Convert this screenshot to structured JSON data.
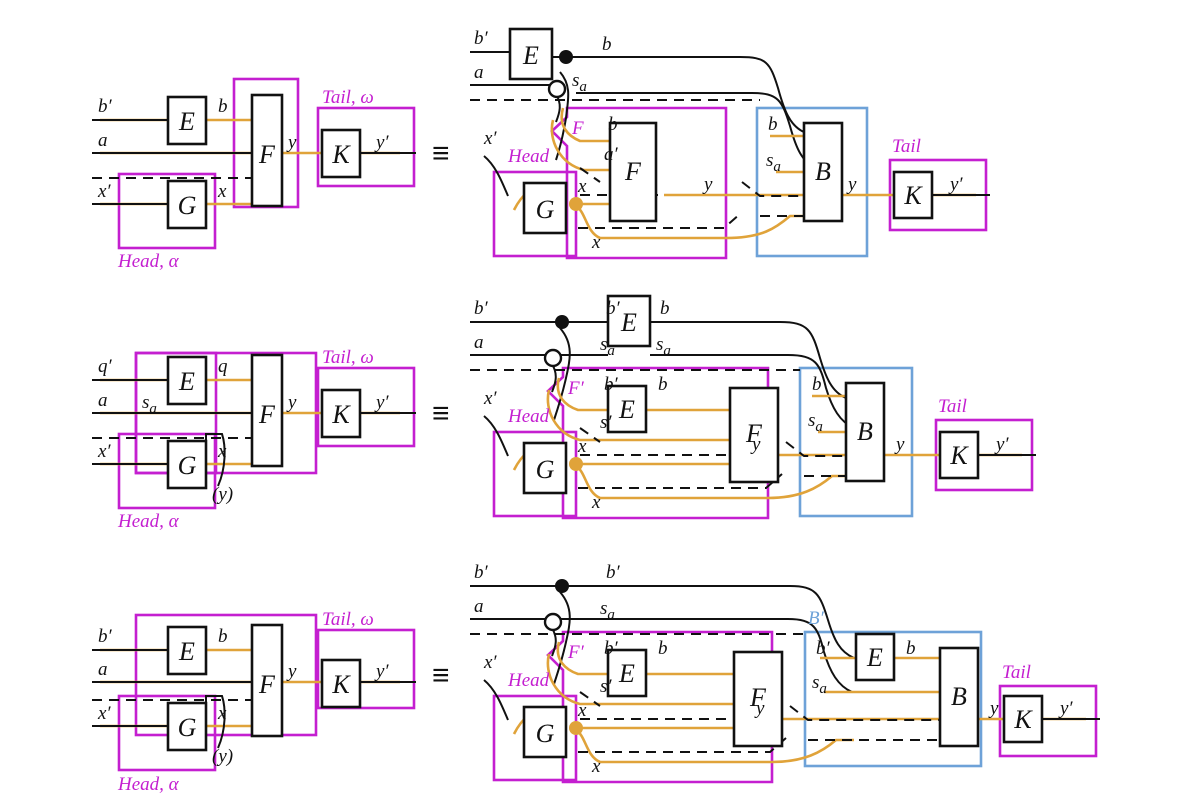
{
  "figure": {
    "title": "String diagram equivalences for Head/Tail decomposition",
    "domain": "Diagram",
    "colors": {
      "wire_black": "#111111",
      "wire_orange": "#e0a33a",
      "group_purple": "#c41fd0",
      "group_blue": "#6ea2d8",
      "box_stroke": "#111111",
      "background": "#ffffff"
    },
    "equiv_symbol": "≡",
    "glyphs": {
      "copy_dot": "black-filled-dot",
      "discard_circle": "open-circle",
      "orange_copy_dot": "orange-filled-dot"
    }
  },
  "rows": [
    {
      "id": "row-1",
      "left": {
        "boxes": [
          {
            "name": "E",
            "label": "E"
          },
          {
            "name": "F",
            "label": "F"
          },
          {
            "name": "G",
            "label": "G"
          },
          {
            "name": "K",
            "label": "K"
          }
        ],
        "wire_labels": [
          "b′",
          "a",
          "x′",
          "b",
          "x",
          "y",
          "y′"
        ],
        "groups": [
          {
            "name": "head",
            "label": "Head, α",
            "color": "#c41fd0"
          },
          {
            "name": "tail",
            "label": "Tail, ω",
            "color": "#c41fd0"
          },
          {
            "name": "f-outer",
            "label": "",
            "color": "#c41fd0"
          }
        ]
      },
      "right": {
        "boxes": [
          {
            "name": "E",
            "label": "E"
          },
          {
            "name": "G",
            "label": "G"
          },
          {
            "name": "F",
            "label": "F"
          },
          {
            "name": "B",
            "label": "B"
          },
          {
            "name": "K",
            "label": "K"
          }
        ],
        "wire_labels": [
          "b′",
          "a",
          "b",
          "s_a",
          "x′",
          "b",
          "a′",
          "x",
          "x",
          "y",
          "b",
          "s_a",
          "y",
          "y′"
        ],
        "groups": [
          {
            "name": "head",
            "label": "Head",
            "color": "#c41fd0"
          },
          {
            "name": "f-prime",
            "label": "F",
            "color": "#c41fd0"
          },
          {
            "name": "b-block",
            "label": "",
            "color": "#6ea2d8"
          },
          {
            "name": "tail",
            "label": "Tail",
            "color": "#c41fd0"
          }
        ]
      }
    },
    {
      "id": "row-2",
      "left": {
        "boxes": [
          {
            "name": "E",
            "label": "E"
          },
          {
            "name": "F",
            "label": "F"
          },
          {
            "name": "G",
            "label": "G"
          },
          {
            "name": "K",
            "label": "K"
          }
        ],
        "wire_labels": [
          "q′",
          "a",
          "x′",
          "q",
          "s_a",
          "x",
          "(y)",
          "y",
          "y′"
        ],
        "groups": [
          {
            "name": "head",
            "label": "Head, α",
            "color": "#c41fd0"
          },
          {
            "name": "tail",
            "label": "Tail, ω",
            "color": "#c41fd0"
          },
          {
            "name": "f-outer",
            "label": "",
            "color": "#c41fd0"
          }
        ]
      },
      "right": {
        "boxes": [
          {
            "name": "E-top",
            "label": "E"
          },
          {
            "name": "G",
            "label": "G"
          },
          {
            "name": "E-inner",
            "label": "E"
          },
          {
            "name": "F",
            "label": "F"
          },
          {
            "name": "B",
            "label": "B"
          },
          {
            "name": "K",
            "label": "K"
          }
        ],
        "wire_labels": [
          "b′",
          "a",
          "b′",
          "s_a",
          "b",
          "s_a",
          "x′",
          "b′",
          "s′",
          "b",
          "x",
          "x",
          "y",
          "b",
          "s_a",
          "y",
          "y′"
        ],
        "groups": [
          {
            "name": "head",
            "label": "Head",
            "color": "#c41fd0"
          },
          {
            "name": "f-prime",
            "label": "F′",
            "color": "#c41fd0"
          },
          {
            "name": "b-block",
            "label": "",
            "color": "#6ea2d8"
          },
          {
            "name": "tail",
            "label": "Tail",
            "color": "#c41fd0"
          }
        ]
      }
    },
    {
      "id": "row-3",
      "left": {
        "boxes": [
          {
            "name": "E",
            "label": "E"
          },
          {
            "name": "F",
            "label": "F"
          },
          {
            "name": "G",
            "label": "G"
          },
          {
            "name": "K",
            "label": "K"
          }
        ],
        "wire_labels": [
          "b′",
          "a",
          "x′",
          "b",
          "x",
          "(y)",
          "y",
          "y′"
        ],
        "groups": [
          {
            "name": "head",
            "label": "Head, α",
            "color": "#c41fd0"
          },
          {
            "name": "tail",
            "label": "Tail, ω",
            "color": "#c41fd0"
          },
          {
            "name": "f-outer",
            "label": "",
            "color": "#c41fd0"
          }
        ]
      },
      "right": {
        "boxes": [
          {
            "name": "G",
            "label": "G"
          },
          {
            "name": "E-inner",
            "label": "E"
          },
          {
            "name": "F",
            "label": "F"
          },
          {
            "name": "E-b",
            "label": "E"
          },
          {
            "name": "B",
            "label": "B"
          },
          {
            "name": "K",
            "label": "K"
          }
        ],
        "wire_labels": [
          "b′",
          "a",
          "b′",
          "s_a",
          "x′",
          "b′",
          "s′",
          "b",
          "x",
          "x",
          "y",
          "b′",
          "s_a",
          "b",
          "y",
          "y′"
        ],
        "groups": [
          {
            "name": "head",
            "label": "Head",
            "color": "#c41fd0"
          },
          {
            "name": "f-prime",
            "label": "F′",
            "color": "#c41fd0"
          },
          {
            "name": "b-prime-block",
            "label": "B′",
            "color": "#6ea2d8"
          },
          {
            "name": "tail",
            "label": "Tail",
            "color": "#c41fd0"
          }
        ]
      }
    }
  ],
  "texts": {
    "E": "E",
    "F": "F",
    "G": "G",
    "K": "K",
    "B": "B",
    "b": "b",
    "bp": "b′",
    "a": "a",
    "ap": "a′",
    "sa": "s",
    "sa_sub": "a",
    "sp": "s′",
    "x": "x",
    "xp": "x′",
    "y": "y",
    "yp": "y′",
    "q": "q",
    "qp": "q′",
    "yparen": "(y)",
    "head_alpha": "Head, α",
    "tail_omega": "Tail, ω",
    "head": "Head",
    "tail": "Tail",
    "Fp": "F′",
    "F_lab": "F",
    "Bp": "B′",
    "equiv": "≡"
  }
}
